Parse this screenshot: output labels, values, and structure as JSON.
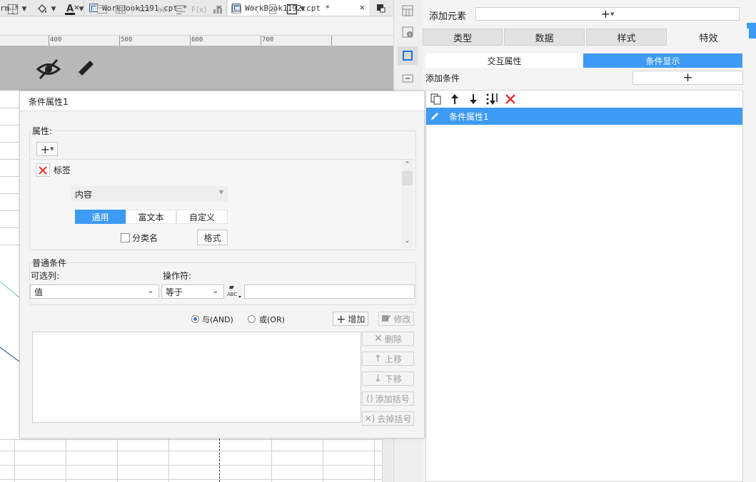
{
  "tabs": [
    {
      "label": "rm *"
    },
    {
      "label": "WorkBook1191.cpt *"
    },
    {
      "label": "WorkBook1192.cpt *"
    }
  ],
  "ruler": {
    "marks": [
      "400",
      "500",
      "600",
      "700"
    ]
  },
  "right_panel": {
    "add_element_label": "添加元素",
    "categories": [
      "类型",
      "数据",
      "样式",
      "特效"
    ],
    "subtabs": [
      "交互属性",
      "条件显示"
    ],
    "add_condition_label": "添加条件",
    "condition_items": [
      "条件属性1"
    ]
  },
  "dialog": {
    "title": "条件属性1",
    "attr_label": "属性:",
    "attr_item_label": "标签",
    "content_combo": "内容",
    "mode_tabs": [
      "通用",
      "富文本",
      "自定义"
    ],
    "classname_checkbox": "分类名",
    "format_button": "格式",
    "normal_condition_label": "普通条件",
    "optional_col_label": "可选列:",
    "operator_label": "操作符:",
    "col_value": "值",
    "operator_value": "等于",
    "and_label": "与(AND)",
    "or_label": "或(OR)",
    "add_button": "增加",
    "modify_button": "修改",
    "delete_button": "删除",
    "move_up_button": "上移",
    "move_down_button": "下移",
    "add_bracket_button": "添加括号",
    "remove_bracket_button": "去掉括号"
  },
  "colors": {
    "accent": "#3d9bf5",
    "delete_red": "#e0322f"
  }
}
